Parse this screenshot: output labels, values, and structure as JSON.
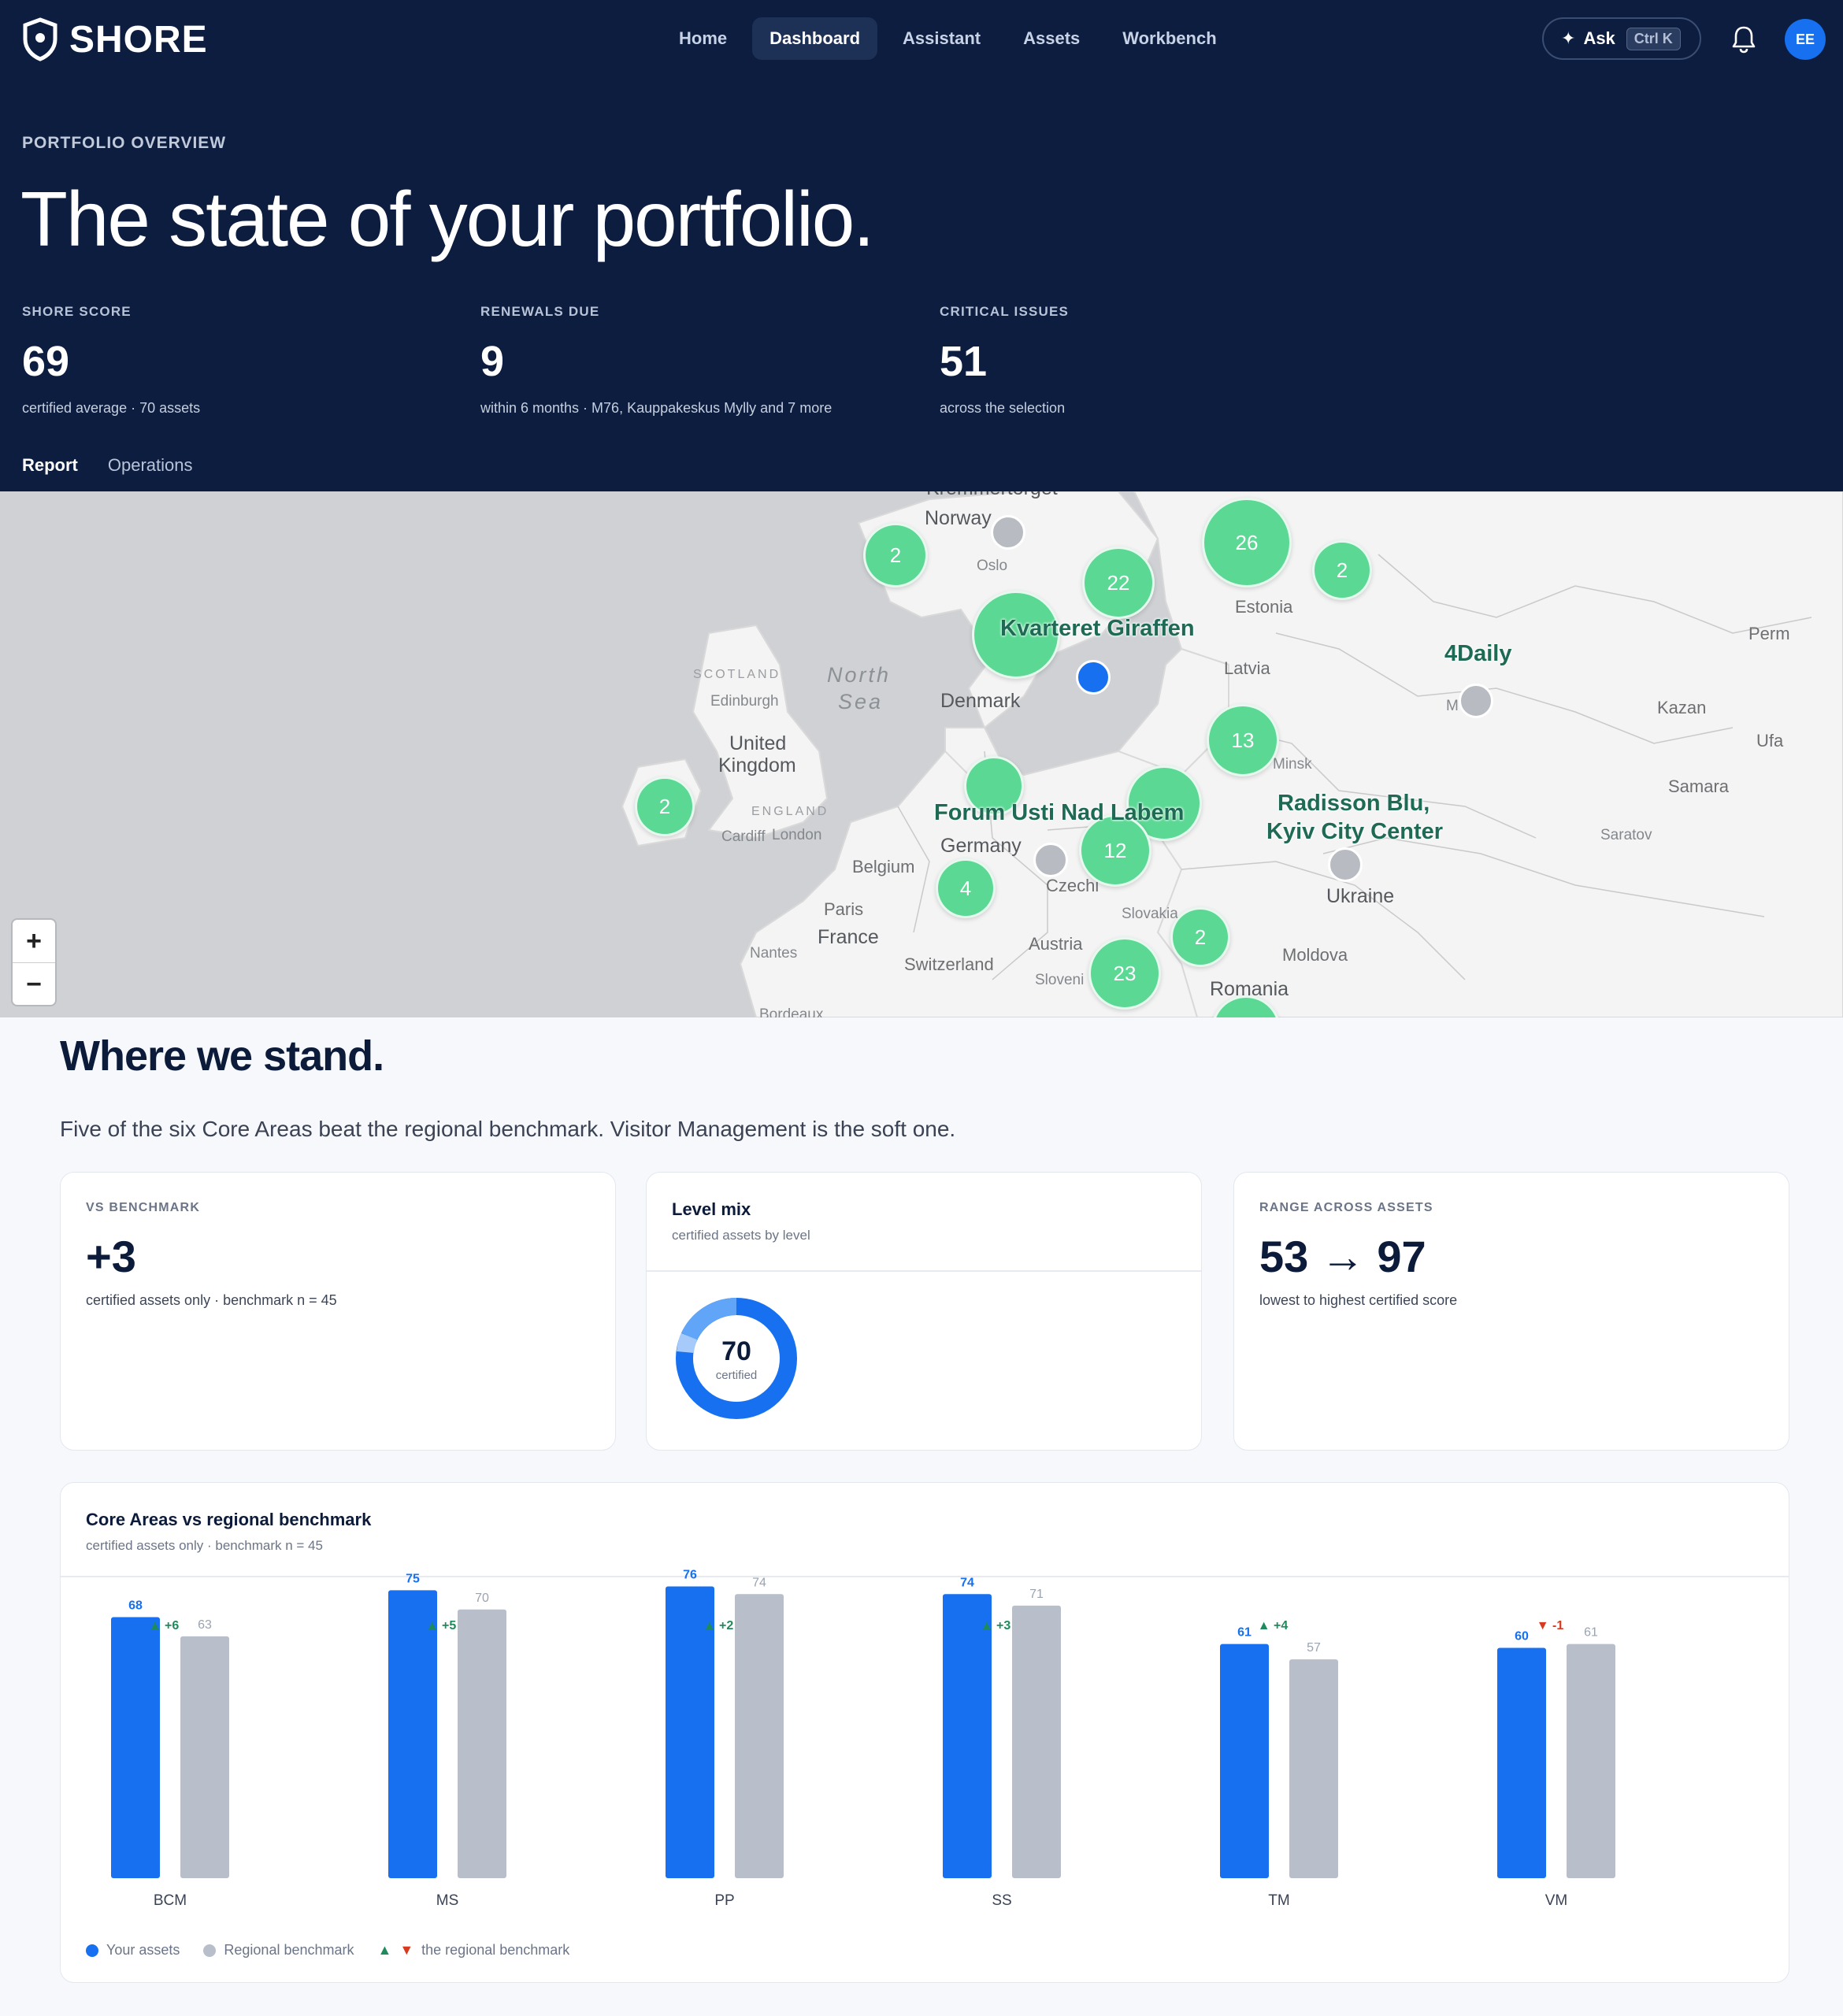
{
  "app": {
    "name": "SHORE"
  },
  "nav": [
    {
      "label": "Home",
      "active": false
    },
    {
      "label": "Dashboard",
      "active": true
    },
    {
      "label": "Assistant",
      "active": false
    },
    {
      "label": "Assets",
      "active": false
    },
    {
      "label": "Workbench",
      "active": false
    }
  ],
  "ask": {
    "label": "Ask",
    "shortcut": "Ctrl K"
  },
  "user": {
    "initials": "EE"
  },
  "hero": {
    "eyebrow": "PORTFOLIO OVERVIEW",
    "title": "The state of your portfolio.",
    "kpis": [
      {
        "label": "SHORE SCORE",
        "value": "69",
        "sub": "certified average · 70 assets"
      },
      {
        "label": "RENEWALS DUE",
        "value": "9",
        "sub": "within 6 months · M76, Kauppakeskus Mylly and 7 more"
      },
      {
        "label": "CRITICAL ISSUES",
        "value": "51",
        "sub": "across the selection"
      }
    ],
    "tabs": [
      {
        "label": "Report",
        "active": true
      },
      {
        "label": "Operations",
        "active": false
      }
    ]
  },
  "map": {
    "labels": {
      "norway": "Norway",
      "oslo": "Oslo",
      "estonia": "Estonia",
      "latvia": "Latvia",
      "north": "North",
      "sea": "Sea",
      "scotland": "SCOTLAND",
      "edinburgh": "Edinburgh",
      "denmark": "Denmark",
      "united": "United",
      "kingdom": "Kingdom",
      "england": "ENGLAND",
      "cardiff": "Cardiff",
      "london": "London",
      "belgium": "Belgium",
      "germany": "Germany",
      "paris": "Paris",
      "france": "France",
      "nantes": "Nantes",
      "switzerland": "Switzerland",
      "austria": "Austria",
      "slovenia": "Sloveni",
      "slovakia": "Slovakia",
      "czech": "Czechi",
      "minsk": "Minsk",
      "ukraine": "Ukraine",
      "moldova": "Moldova",
      "romania": "Romania",
      "kazan": "Kazan",
      "perm": "Perm",
      "ufa": "Ufa",
      "samara": "Samara",
      "saratov": "Saratov",
      "moscow": "M    w",
      "bordeaux": "Bordeaux",
      "top": "Kremmertorget"
    },
    "clusters": [
      "2",
      "22",
      "26",
      "2",
      "13",
      "2",
      "12",
      "4",
      "2",
      "23"
    ],
    "asset_labels": {
      "kvarteret": "Kvarteret Giraffen",
      "forum": "Forum Usti Nad Labem",
      "radisson1": "Radisson Blu,",
      "radisson2": "Kyiv City Center",
      "fourdaily": "4Daily"
    },
    "zoom": {
      "in": "+",
      "out": "−"
    }
  },
  "stand": {
    "title": "Where we stand.",
    "subtitle": "Five of the six Core Areas beat the regional benchmark. Visitor Management is the soft one.",
    "benchmark_card": {
      "eyebrow": "VS BENCHMARK",
      "value": "+3",
      "sub": "certified assets only · benchmark n = 45"
    },
    "level_card": {
      "title": "Level mix",
      "caption": "certified assets by level",
      "total": "70",
      "total_label": "certified"
    },
    "range_card": {
      "eyebrow": "RANGE ACROSS ASSETS",
      "value": "53 → 97",
      "sub": "lowest to highest certified score"
    }
  },
  "core_chart": {
    "title": "Core Areas vs regional benchmark",
    "caption": "certified assets only · benchmark n = 45",
    "legend": {
      "yours": "Your assets",
      "benchmark": "Regional benchmark",
      "delta": "the regional benchmark"
    }
  },
  "colors": {
    "navy": "#0c1d3f",
    "accent": "#1670f0",
    "benchmark": "#b8bfca",
    "up": "#1f8a5b",
    "down": "#d83a1f",
    "cluster": "#5bd893"
  },
  "chart_data": {
    "type": "bar",
    "categories": [
      "BCM",
      "MS",
      "PP",
      "SS",
      "TM",
      "VM"
    ],
    "series": [
      {
        "name": "Your assets",
        "values": [
          68,
          75,
          76,
          74,
          61,
          60
        ]
      },
      {
        "name": "Regional benchmark",
        "values": [
          63,
          70,
          74,
          71,
          57,
          61
        ]
      }
    ],
    "deltas": [
      "+6",
      "+5",
      "+2",
      "+3",
      "+4",
      "-1"
    ],
    "ylim": [
      0,
      80
    ],
    "title": "Core Areas vs regional benchmark",
    "legend": "bottom-left"
  }
}
